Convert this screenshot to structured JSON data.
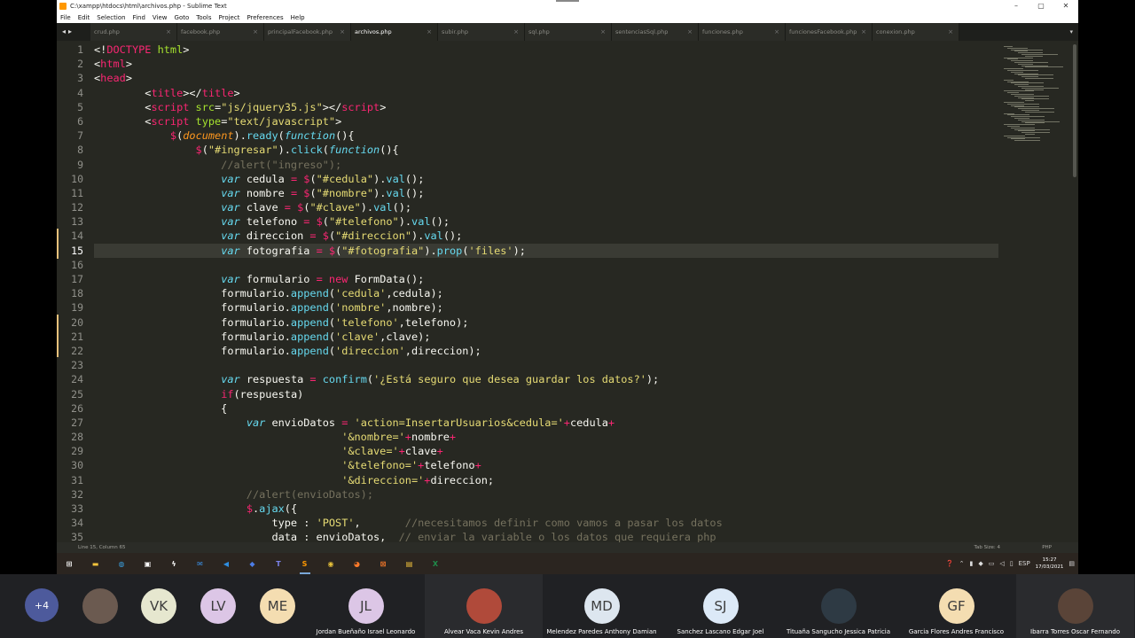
{
  "window": {
    "title": "C:\\xampp\\htdocs\\html\\archivos.php - Sublime Text",
    "controls": [
      "–",
      "▢",
      "✕"
    ]
  },
  "menu": [
    "File",
    "Edit",
    "Selection",
    "Find",
    "View",
    "Goto",
    "Tools",
    "Project",
    "Preferences",
    "Help"
  ],
  "tabs": [
    {
      "label": "crud.php"
    },
    {
      "label": "facebook.php"
    },
    {
      "label": "principalFacebook.php"
    },
    {
      "label": "archivos.php",
      "active": true
    },
    {
      "label": "subir.php"
    },
    {
      "label": "sql.php"
    },
    {
      "label": "sentenciasSql.php"
    },
    {
      "label": "funciones.php"
    },
    {
      "label": "funcionesFacebook.php"
    },
    {
      "label": "conexion.php"
    }
  ],
  "editor": {
    "current_line": 15,
    "lines": [
      [
        [
          "<!",
          "p"
        ],
        [
          "DOCTYPE",
          "k"
        ],
        [
          " html",
          "a"
        ],
        [
          ">",
          "p"
        ]
      ],
      [
        [
          "<",
          "p"
        ],
        [
          "html",
          "k"
        ],
        [
          ">",
          "p"
        ]
      ],
      [
        [
          "<",
          "p"
        ],
        [
          "head",
          "k"
        ],
        [
          ">",
          "p"
        ]
      ],
      [
        [
          "        <",
          "p"
        ],
        [
          "title",
          "k"
        ],
        [
          "></",
          "p"
        ],
        [
          "title",
          "k"
        ],
        [
          ">",
          "p"
        ]
      ],
      [
        [
          "        <",
          "p"
        ],
        [
          "script",
          "k"
        ],
        [
          " src",
          "a"
        ],
        [
          "=",
          "p"
        ],
        [
          "\"js/jquery35.js\"",
          "s"
        ],
        [
          "></",
          "p"
        ],
        [
          "script",
          "k"
        ],
        [
          ">",
          "p"
        ]
      ],
      [
        [
          "        <",
          "p"
        ],
        [
          "script",
          "k"
        ],
        [
          " type",
          "a"
        ],
        [
          "=",
          "p"
        ],
        [
          "\"text/javascript\"",
          "s"
        ],
        [
          ">",
          "p"
        ]
      ],
      [
        [
          "            ",
          "p"
        ],
        [
          "$",
          "k"
        ],
        [
          "(",
          "p"
        ],
        [
          "document",
          "i"
        ],
        [
          ").",
          "p"
        ],
        [
          "ready",
          "f"
        ],
        [
          "(",
          "p"
        ],
        [
          "function",
          "v"
        ],
        [
          "(){",
          "p"
        ]
      ],
      [
        [
          "                ",
          "p"
        ],
        [
          "$",
          "k"
        ],
        [
          "(",
          "p"
        ],
        [
          "\"#ingresar\"",
          "s"
        ],
        [
          ").",
          "p"
        ],
        [
          "click",
          "f"
        ],
        [
          "(",
          "p"
        ],
        [
          "function",
          "v"
        ],
        [
          "(){",
          "p"
        ]
      ],
      [
        [
          "                    //alert(\"ingreso\");",
          "c"
        ]
      ],
      [
        [
          "                    ",
          "p"
        ],
        [
          "var",
          "v"
        ],
        [
          " cedula ",
          "p"
        ],
        [
          "=",
          "k"
        ],
        [
          " ",
          "p"
        ],
        [
          "$",
          "k"
        ],
        [
          "(",
          "p"
        ],
        [
          "\"#cedula\"",
          "s"
        ],
        [
          ").",
          "p"
        ],
        [
          "val",
          "f"
        ],
        [
          "();",
          "p"
        ]
      ],
      [
        [
          "                    ",
          "p"
        ],
        [
          "var",
          "v"
        ],
        [
          " nombre ",
          "p"
        ],
        [
          "=",
          "k"
        ],
        [
          " ",
          "p"
        ],
        [
          "$",
          "k"
        ],
        [
          "(",
          "p"
        ],
        [
          "\"#nombre\"",
          "s"
        ],
        [
          ").",
          "p"
        ],
        [
          "val",
          "f"
        ],
        [
          "();",
          "p"
        ]
      ],
      [
        [
          "                    ",
          "p"
        ],
        [
          "var",
          "v"
        ],
        [
          " clave ",
          "p"
        ],
        [
          "=",
          "k"
        ],
        [
          " ",
          "p"
        ],
        [
          "$",
          "k"
        ],
        [
          "(",
          "p"
        ],
        [
          "\"#clave\"",
          "s"
        ],
        [
          ").",
          "p"
        ],
        [
          "val",
          "f"
        ],
        [
          "();",
          "p"
        ]
      ],
      [
        [
          "                    ",
          "p"
        ],
        [
          "var",
          "v"
        ],
        [
          " telefono ",
          "p"
        ],
        [
          "=",
          "k"
        ],
        [
          " ",
          "p"
        ],
        [
          "$",
          "k"
        ],
        [
          "(",
          "p"
        ],
        [
          "\"#telefono\"",
          "s"
        ],
        [
          ").",
          "p"
        ],
        [
          "val",
          "f"
        ],
        [
          "();",
          "p"
        ]
      ],
      [
        [
          "                    ",
          "p"
        ],
        [
          "var",
          "v"
        ],
        [
          " direccion ",
          "p"
        ],
        [
          "=",
          "k"
        ],
        [
          " ",
          "p"
        ],
        [
          "$",
          "k"
        ],
        [
          "(",
          "p"
        ],
        [
          "\"#direccion\"",
          "s"
        ],
        [
          ").",
          "p"
        ],
        [
          "val",
          "f"
        ],
        [
          "();",
          "p"
        ]
      ],
      [
        [
          "                    ",
          "p"
        ],
        [
          "var",
          "v"
        ],
        [
          " fotografia ",
          "p"
        ],
        [
          "=",
          "k"
        ],
        [
          " ",
          "p"
        ],
        [
          "$",
          "k"
        ],
        [
          "(",
          "p"
        ],
        [
          "\"#fotografia\"",
          "s"
        ],
        [
          ").",
          "p"
        ],
        [
          "prop",
          "f"
        ],
        [
          "(",
          "p"
        ],
        [
          "'files'",
          "s"
        ],
        [
          ");",
          "p"
        ]
      ],
      [
        [
          "",
          "p"
        ]
      ],
      [
        [
          "                    ",
          "p"
        ],
        [
          "var",
          "v"
        ],
        [
          " formulario ",
          "p"
        ],
        [
          "=",
          "k"
        ],
        [
          " ",
          "p"
        ],
        [
          "new",
          "k"
        ],
        [
          " FormData();",
          "p"
        ]
      ],
      [
        [
          "                    formulario.",
          "p"
        ],
        [
          "append",
          "f"
        ],
        [
          "(",
          "p"
        ],
        [
          "'cedula'",
          "s"
        ],
        [
          ",cedula);",
          "p"
        ]
      ],
      [
        [
          "                    formulario.",
          "p"
        ],
        [
          "append",
          "f"
        ],
        [
          "(",
          "p"
        ],
        [
          "'nombre'",
          "s"
        ],
        [
          ",nombre);",
          "p"
        ]
      ],
      [
        [
          "                    formulario.",
          "p"
        ],
        [
          "append",
          "f"
        ],
        [
          "(",
          "p"
        ],
        [
          "'telefono'",
          "s"
        ],
        [
          ",telefono);",
          "p"
        ]
      ],
      [
        [
          "                    formulario.",
          "p"
        ],
        [
          "append",
          "f"
        ],
        [
          "(",
          "p"
        ],
        [
          "'clave'",
          "s"
        ],
        [
          ",clave);",
          "p"
        ]
      ],
      [
        [
          "                    formulario.",
          "p"
        ],
        [
          "append",
          "f"
        ],
        [
          "(",
          "p"
        ],
        [
          "'direccion'",
          "s"
        ],
        [
          ",direccion);",
          "p"
        ]
      ],
      [
        [
          "",
          "p"
        ]
      ],
      [
        [
          "                    ",
          "p"
        ],
        [
          "var",
          "v"
        ],
        [
          " respuesta ",
          "p"
        ],
        [
          "=",
          "k"
        ],
        [
          " ",
          "p"
        ],
        [
          "confirm",
          "f"
        ],
        [
          "(",
          "p"
        ],
        [
          "'¿Está seguro que desea guardar los datos?'",
          "s"
        ],
        [
          ");",
          "p"
        ]
      ],
      [
        [
          "                    ",
          "p"
        ],
        [
          "if",
          "k"
        ],
        [
          "(respuesta)",
          "p"
        ]
      ],
      [
        [
          "                    {",
          "p"
        ]
      ],
      [
        [
          "                        ",
          "p"
        ],
        [
          "var",
          "v"
        ],
        [
          " envioDatos ",
          "p"
        ],
        [
          "=",
          "k"
        ],
        [
          " ",
          "p"
        ],
        [
          "'action=InsertarUsuarios&cedula='",
          "s"
        ],
        [
          "+",
          "k"
        ],
        [
          "cedula",
          "p"
        ],
        [
          "+",
          "k"
        ]
      ],
      [
        [
          "                                       ",
          "p"
        ],
        [
          "'&nombre='",
          "s"
        ],
        [
          "+",
          "k"
        ],
        [
          "nombre",
          "p"
        ],
        [
          "+",
          "k"
        ]
      ],
      [
        [
          "                                       ",
          "p"
        ],
        [
          "'&clave='",
          "s"
        ],
        [
          "+",
          "k"
        ],
        [
          "clave",
          "p"
        ],
        [
          "+",
          "k"
        ]
      ],
      [
        [
          "                                       ",
          "p"
        ],
        [
          "'&telefono='",
          "s"
        ],
        [
          "+",
          "k"
        ],
        [
          "telefono",
          "p"
        ],
        [
          "+",
          "k"
        ]
      ],
      [
        [
          "                                       ",
          "p"
        ],
        [
          "'&direccion='",
          "s"
        ],
        [
          "+",
          "k"
        ],
        [
          "direccion;",
          "p"
        ]
      ],
      [
        [
          "                        //alert(envioDatos);",
          "c"
        ]
      ],
      [
        [
          "                        ",
          "p"
        ],
        [
          "$",
          "k"
        ],
        [
          ".",
          "p"
        ],
        [
          "ajax",
          "f"
        ],
        [
          "({",
          "p"
        ]
      ],
      [
        [
          "                            type : ",
          "p"
        ],
        [
          "'POST'",
          "s"
        ],
        [
          ",       ",
          "p"
        ],
        [
          "//necesitamos definir como vamos a pasar los datos",
          "c"
        ]
      ],
      [
        [
          "                            data : envioDatos,  ",
          "p"
        ],
        [
          "// enviar la variable o los datos que requiera php",
          "c"
        ]
      ]
    ]
  },
  "status": {
    "left": "Line 15, Column 65",
    "tab_size": "Tab Size: 4",
    "syntax": "PHP"
  },
  "taskbar": {
    "lang": "ESP",
    "time": "15:27",
    "date": "17/03/2021",
    "apps": [
      {
        "icon": "windows-start-icon",
        "glyph": "⊞",
        "color": "#ffffff"
      },
      {
        "icon": "file-explorer-icon",
        "glyph": "▬",
        "color": "#f3c33c"
      },
      {
        "icon": "edge-icon",
        "glyph": "◍",
        "color": "#3aa0e0"
      },
      {
        "icon": "store-icon",
        "glyph": "▣",
        "color": "#ffffff"
      },
      {
        "icon": "bolt-app-icon",
        "glyph": "ϟ",
        "color": "#ffffff"
      },
      {
        "icon": "mail-icon",
        "glyph": "✉",
        "color": "#3b8de0"
      },
      {
        "icon": "vscode-icon",
        "glyph": "◀",
        "color": "#2f8ee0"
      },
      {
        "icon": "dropbox-icon",
        "glyph": "◆",
        "color": "#4c7de6"
      },
      {
        "icon": "teams-icon",
        "glyph": "T",
        "color": "#7b83eb"
      },
      {
        "icon": "sublime-icon",
        "glyph": "S",
        "color": "#ff9800"
      },
      {
        "icon": "chrome-icon",
        "glyph": "◉",
        "color": "#e8c23a"
      },
      {
        "icon": "firefox-icon",
        "glyph": "◕",
        "color": "#ff7a2a"
      },
      {
        "icon": "xampp-icon",
        "glyph": "⊠",
        "color": "#f97a2a"
      },
      {
        "icon": "terminal-icon",
        "glyph": "▤",
        "color": "#f3c33c"
      },
      {
        "icon": "excel-icon",
        "glyph": "X",
        "color": "#1f8c4a"
      }
    ]
  },
  "participants": {
    "more_count": "+4",
    "tiles": [
      {
        "initials": "",
        "name": "",
        "photo": true,
        "color": "#6b5a50"
      },
      {
        "initials": "VK",
        "name": "",
        "color": "#e6e7cf"
      },
      {
        "initials": "LV",
        "name": "",
        "color": "#dcc6e6"
      },
      {
        "initials": "ME",
        "name": "",
        "color": "#f4ddb1"
      },
      {
        "initials": "JL",
        "name": "Jordan Bueñaño Israel Leonardo",
        "color": "#dcc6e6"
      },
      {
        "initials": "",
        "name": "Alvear Vaca Kevin Andres",
        "photo": true,
        "color": "#b04a3a"
      },
      {
        "initials": "MD",
        "name": "Melendez Paredes Anthony Damian",
        "color": "#dde6ef"
      },
      {
        "initials": "SJ",
        "name": "Sanchez Lascano Edgar Joel",
        "color": "#dce9f7"
      },
      {
        "initials": "",
        "name": "Tituaña Sangucho Jessica Patricia",
        "photo": true,
        "color": "#2e3a44"
      },
      {
        "initials": "GF",
        "name": "Garcia Flores Andres Francisco",
        "color": "#f4ddb1"
      },
      {
        "initials": "",
        "name": "Ibarra Torres Oscar Fernando",
        "photo": true,
        "color": "#5a4438"
      }
    ]
  }
}
